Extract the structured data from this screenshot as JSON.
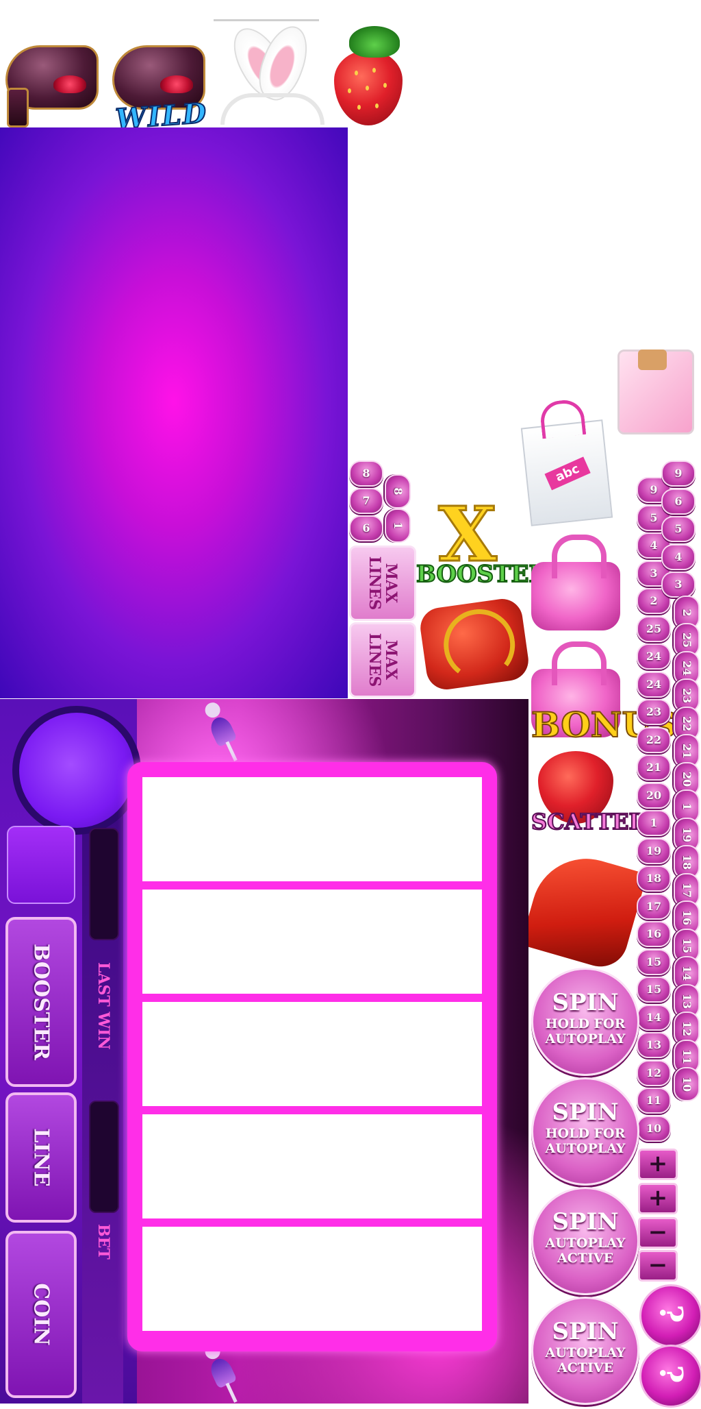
{
  "symbols": {
    "shoe": "shoe-symbol",
    "wild_label": "WILD",
    "bunny_ears": "bunny-ears-symbol",
    "strawberry": "strawberry-symbol"
  },
  "line_numbers": {
    "col1": [
      "8",
      "7",
      "6"
    ],
    "col2": [
      "8",
      "1"
    ]
  },
  "lines_buttons": [
    {
      "label": "MAX\nLINES"
    },
    {
      "label": "MAX\nLINES"
    }
  ],
  "items": {
    "booster_x": "X",
    "booster_label": "BOOSTER",
    "bonus_label": "BONUS",
    "scatter_label": "SCATTER",
    "abc_label": "abc"
  },
  "bet_numbers": {
    "colA": [
      "9",
      "5",
      "4",
      "3",
      "2",
      "25",
      "24",
      "24",
      "23",
      "22",
      "21",
      "20",
      "1",
      "19",
      "18",
      "17",
      "16",
      "15",
      "15",
      "14",
      "13",
      "12",
      "11",
      "10"
    ],
    "colB": [
      "9",
      "6",
      "5",
      "4",
      "3",
      "2",
      "25",
      "24",
      "23",
      "22",
      "21",
      "20",
      "1",
      "19",
      "18",
      "17",
      "16",
      "15",
      "14",
      "13",
      "12",
      "11",
      "10"
    ]
  },
  "spin_buttons": [
    {
      "title": "SPIN",
      "line1": "HOLD FOR",
      "line2": "AUTOPLAY"
    },
    {
      "title": "SPIN",
      "line1": "HOLD FOR",
      "line2": "AUTOPLAY"
    },
    {
      "title": "SPIN",
      "line1": "AUTOPLAY",
      "line2": "ACTIVE"
    },
    {
      "title": "SPIN",
      "line1": "AUTOPLAY",
      "line2": "ACTIVE"
    }
  ],
  "step_buttons": [
    "+",
    "+",
    "−",
    "−"
  ],
  "help_buttons": [
    "?",
    "?"
  ],
  "side_controls": {
    "booster": "BOOSTER",
    "line": "LINE",
    "coin": "COIN",
    "last_win": "LAST WIN",
    "bet": "BET"
  },
  "colors": {
    "accent_pink": "#ff2ee8",
    "purple_bg": "#7a14d6",
    "magenta_glow": "#ff12e8"
  }
}
